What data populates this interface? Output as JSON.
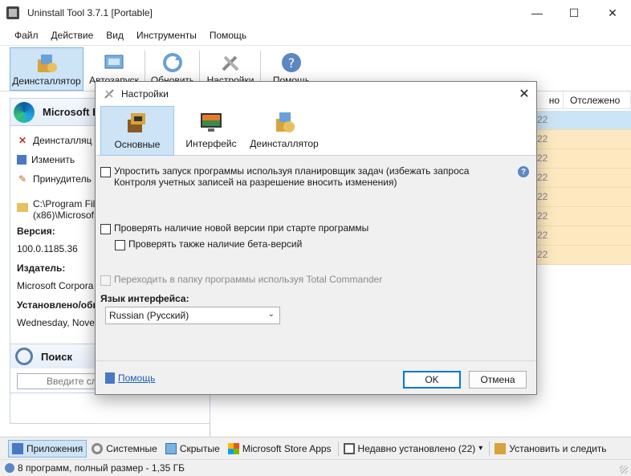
{
  "window": {
    "title": "Uninstall Tool 3.7.1 [Portable]",
    "min_glyph": "—",
    "max_glyph": "☐",
    "close_glyph": "✕"
  },
  "menu": [
    "Файл",
    "Действие",
    "Вид",
    "Инструменты",
    "Помощь"
  ],
  "toolbar": {
    "uninstaller": "Деинсталлятор",
    "autorun": "Автозапуск",
    "refresh": "Обновить",
    "settings": "Настройки",
    "help": "Помощь"
  },
  "app_panel": {
    "title": "Microsoft E",
    "actions": {
      "uninstall": "Деинсталляц",
      "modify": "Изменить",
      "force": "Принудитель"
    },
    "path_line1": "C:\\Program Fil",
    "path_line2": "(x86)\\Microsof",
    "version_label": "Версия:",
    "version_value": "100.0.1185.36",
    "publisher_label": "Издатель:",
    "publisher_value": "Microsoft Corpora",
    "installed_label": "Установлено/обн",
    "installed_value": "Wednesday, Nover"
  },
  "search": {
    "title": "Поиск",
    "placeholder": "Введите сл"
  },
  "list": {
    "col_size_tail": "но",
    "col_tracked": "Отслежено",
    "row_values": [
      "22",
      "22",
      "22",
      "22",
      "22",
      "22",
      "22",
      "22"
    ]
  },
  "bottom_tabs": {
    "apps": "Приложения",
    "system": "Системные",
    "hidden": "Скрытые",
    "store": "Microsoft Store Apps",
    "recent": "Недавно установлено (22)",
    "recent_arrow": "▾",
    "install_track": "Установить и следить"
  },
  "status": {
    "text": "8 программ, полный размер - 1,35 ГБ"
  },
  "dialog": {
    "title": "Настройки",
    "close_glyph": "✕",
    "tabs": {
      "general": "Основные",
      "interface": "Интерфейс",
      "uninstaller": "Деинсталлятор"
    },
    "opt_scheduler_line1": "Упростить запуск программы используя планировщик задач (избежать запроса",
    "opt_scheduler_line2": "Контроля учетных записей на разрешение вносить изменения)",
    "opt_check_updates": "Проверять наличие новой версии при старте программы",
    "opt_check_beta": "Проверять также наличие бета-версий",
    "opt_total_commander": "Переходить в папку программы используя Total Commander",
    "language_label": "Язык интерфейса:",
    "language_value": "Russian (Русский)",
    "help_link": "Помощь",
    "ok": "OK",
    "cancel": "Отмена",
    "help_glyph": "?"
  },
  "colors": {
    "selection_blue": "#cde4f7",
    "row_orange": "#fde8c0",
    "accent": "#0078d4"
  }
}
